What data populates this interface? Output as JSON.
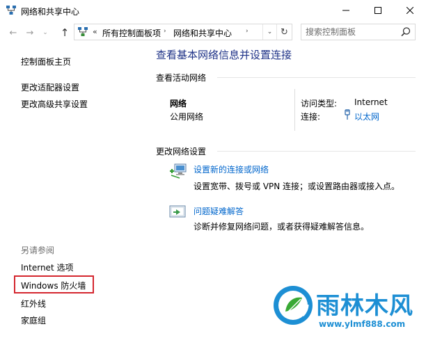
{
  "window": {
    "title": "网络和共享中心",
    "minimize_label": "—",
    "maximize_label": "☐",
    "close_label": "✕",
    "icon": "network-center-icon"
  },
  "navigation": {
    "back_glyph": "←",
    "forward_glyph": "→",
    "recent_glyph": "⌄",
    "up_glyph": "↑"
  },
  "address_bar": {
    "overflow_glyph": "«",
    "breadcrumbs": [
      "所有控制面板项",
      "网络和共享中心"
    ],
    "separator_glyph": "›",
    "dropdown_glyph": "⌄",
    "refresh_glyph": "↻"
  },
  "search": {
    "placeholder": "搜索控制面板"
  },
  "sidebar": {
    "items": [
      "控制面板主页",
      "更改适配器设置",
      "更改高级共享设置"
    ],
    "see_also_title": "另请参阅",
    "see_also_items": [
      "Internet 选项",
      "Windows 防火墙",
      "红外线",
      "家庭组"
    ]
  },
  "main": {
    "title": "查看基本网络信息并设置连接",
    "active_section": {
      "heading": "查看活动网络",
      "network_name": "网络",
      "network_type": "公用网络",
      "access_type_label": "访问类型:",
      "access_type_value": "Internet",
      "connection_label": "连接:",
      "connection_value": "以太网"
    },
    "change_section": {
      "heading": "更改网络设置",
      "tasks": [
        {
          "link": "设置新的连接或网络",
          "desc": "设置宽带、拨号或 VPN 连接；或设置路由器或接入点。"
        },
        {
          "link": "问题疑难解答",
          "desc": "诊断并修复网络问题，或者获得疑难解答信息。"
        }
      ]
    }
  },
  "watermark": {
    "brand": "雨林木风",
    "url": "www.ylmf888.com"
  },
  "colors": {
    "title_blue": "#1e3287",
    "link_blue": "#0066cc",
    "highlight_red": "#d4262e",
    "watermark_blue": "#1d8fd4"
  }
}
